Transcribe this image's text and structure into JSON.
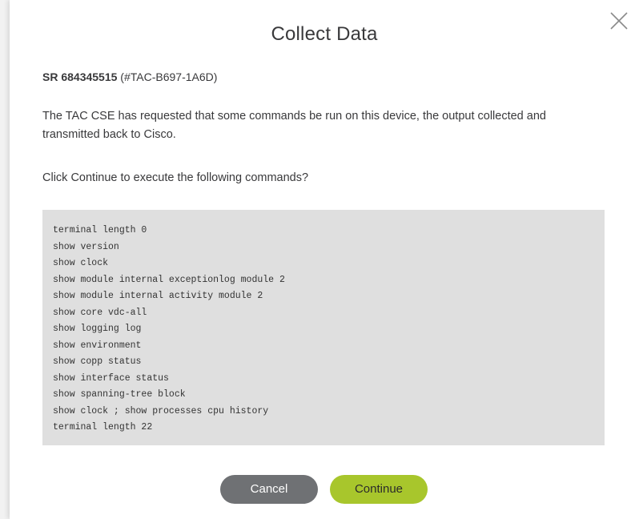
{
  "dialog": {
    "title": "Collect Data",
    "sr_number": "SR 684345515",
    "sr_reference": " (#TAC-B697-1A6D)",
    "description": "The TAC CSE has requested that some commands be run on this device, the output collected and transmitted back to Cisco.",
    "prompt": "Click Continue to execute the following commands?",
    "commands": [
      "terminal length 0",
      "show version",
      "show clock",
      "show module internal exceptionlog module 2",
      "show module internal activity module 2",
      "show core vdc-all",
      "show logging log",
      "show environment",
      "show copp status",
      "show interface status",
      "show spanning-tree block",
      "show clock ; show processes cpu history",
      "terminal length 22"
    ],
    "cancel_label": "Cancel",
    "continue_label": "Continue",
    "close_icon": "close-icon"
  },
  "colors": {
    "cancel_bg": "#6f7174",
    "continue_bg": "#a8c62c",
    "command_box_bg": "#dfdfdf"
  }
}
